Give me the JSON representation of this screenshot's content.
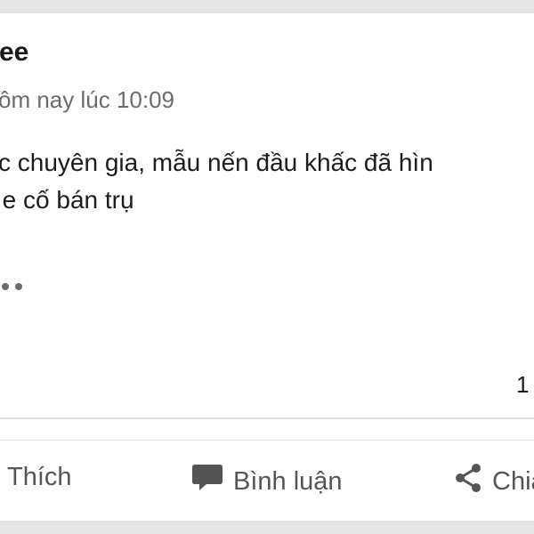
{
  "post": {
    "author": "ee",
    "timestamp": "ôm nay lúc 10:09",
    "body_line1": "c chuyên gia, mẫu nến đầu khấc đã hìn",
    "body_line2": " e cố bán trụ",
    "reaction_count": "1"
  },
  "actions": {
    "like_label": "Thích",
    "comment_label": "Bình luận",
    "share_label": "Chia"
  },
  "icons": {
    "more": "more-dots-icon",
    "comment": "speech-bubble-icon",
    "share": "share-icon"
  },
  "colors": {
    "background": "#e6e6e6",
    "card": "#ffffff",
    "text": "#1c1c1c",
    "muted": "#6b6b6b",
    "action_icon": "#555555"
  }
}
